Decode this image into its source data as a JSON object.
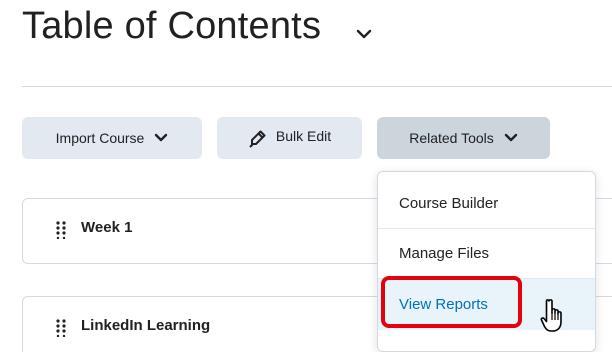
{
  "page": {
    "title": "Table of Contents"
  },
  "toolbar": {
    "import_label": "Import Course",
    "bulk_edit_label": "Bulk Edit",
    "related_tools_label": "Related Tools"
  },
  "modules": [
    {
      "title": "Week 1"
    },
    {
      "title": "LinkedIn Learning"
    }
  ],
  "related_menu": {
    "items": [
      {
        "label": "Course Builder"
      },
      {
        "label": "Manage Files"
      },
      {
        "label": "View Reports"
      }
    ],
    "highlighted": "View Reports"
  },
  "colors": {
    "accent_blue": "#006fbf",
    "button_bg": "#e3e9f1",
    "button_active_bg": "#cdd5dc",
    "highlight_red": "#e3000f",
    "menu_hover_bg": "#e8f4fa"
  },
  "icons": [
    "title-chevron-icon",
    "chevron-down-icon",
    "pencil-icon",
    "drag-handle-icon",
    "hand-cursor-icon"
  ]
}
